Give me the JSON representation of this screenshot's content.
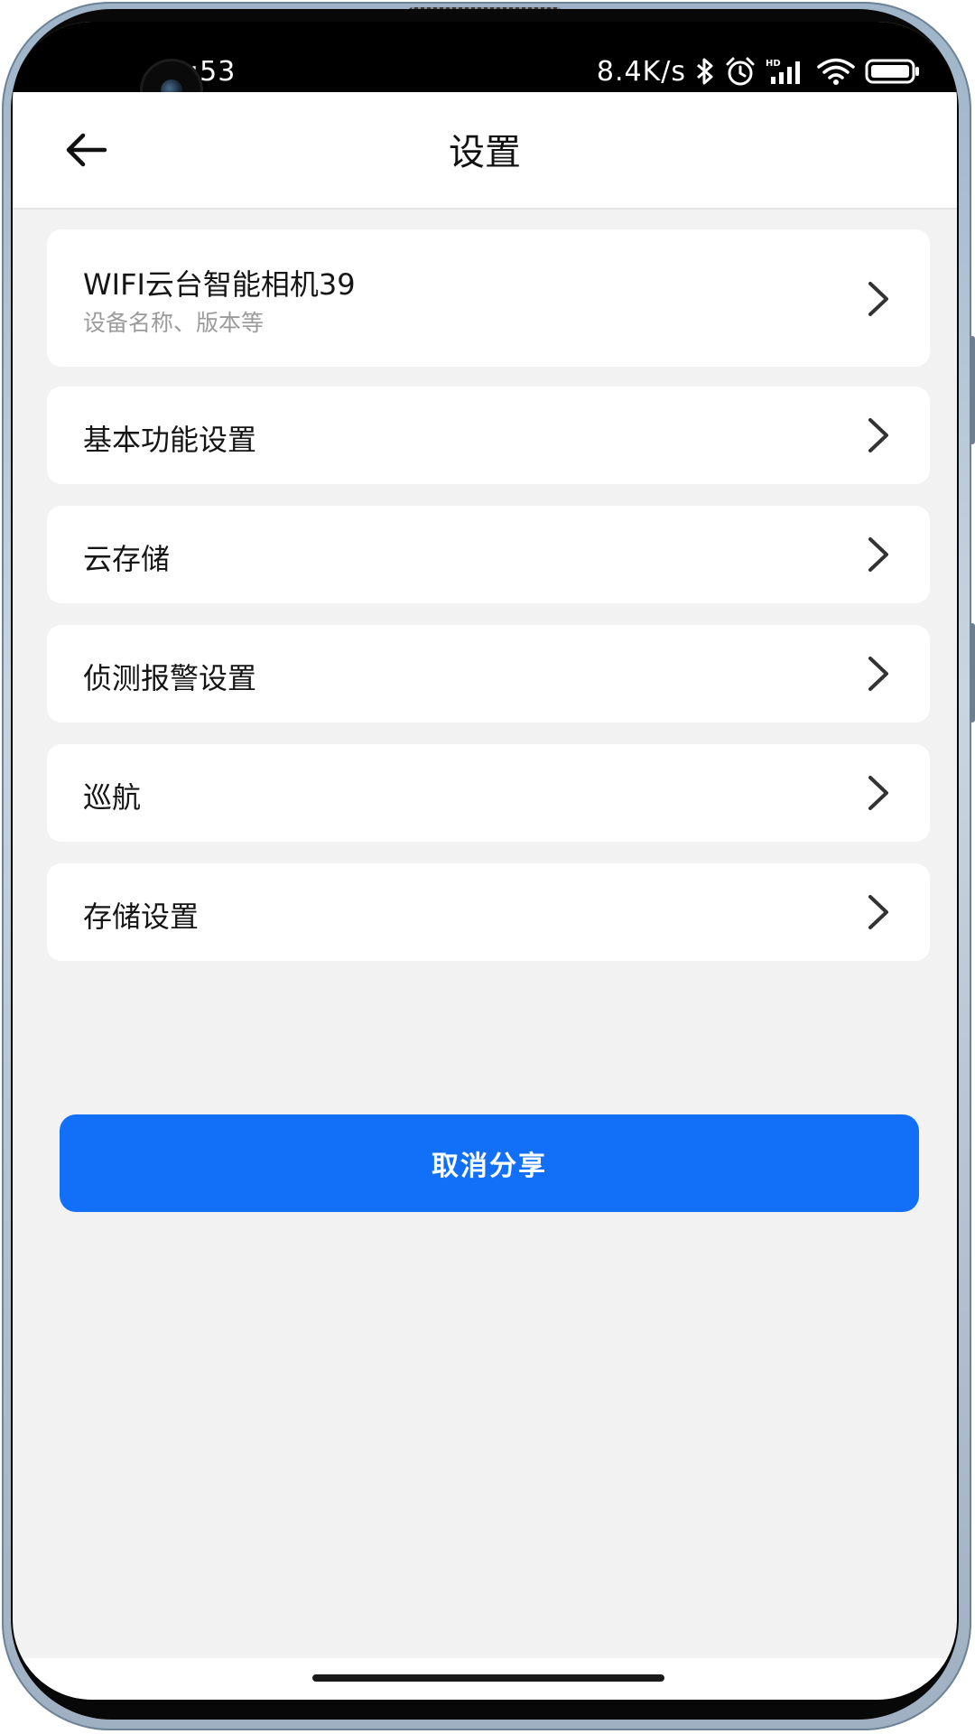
{
  "status_bar": {
    "time": ":53",
    "network_speed": "8.4K/s",
    "icons": [
      "bluetooth-icon",
      "alarm-icon",
      "hd-signal-icon",
      "wifi-icon",
      "battery-icon"
    ]
  },
  "header": {
    "title": "设置",
    "back_icon": "arrow-left-icon"
  },
  "settings": {
    "device": {
      "name": "WIFI云台智能相机39",
      "subtitle": "设备名称、版本等"
    },
    "items": [
      {
        "label": "基本功能设置"
      },
      {
        "label": "云存储"
      },
      {
        "label": "侦测报警设置"
      },
      {
        "label": "巡航"
      },
      {
        "label": "存储设置"
      }
    ]
  },
  "actions": {
    "cancel_share_label": "取消分享"
  },
  "colors": {
    "accent": "#1270f8",
    "page_background": "#f2f2f2",
    "card_background": "#ffffff",
    "subtitle_text": "#9b9b9b"
  }
}
